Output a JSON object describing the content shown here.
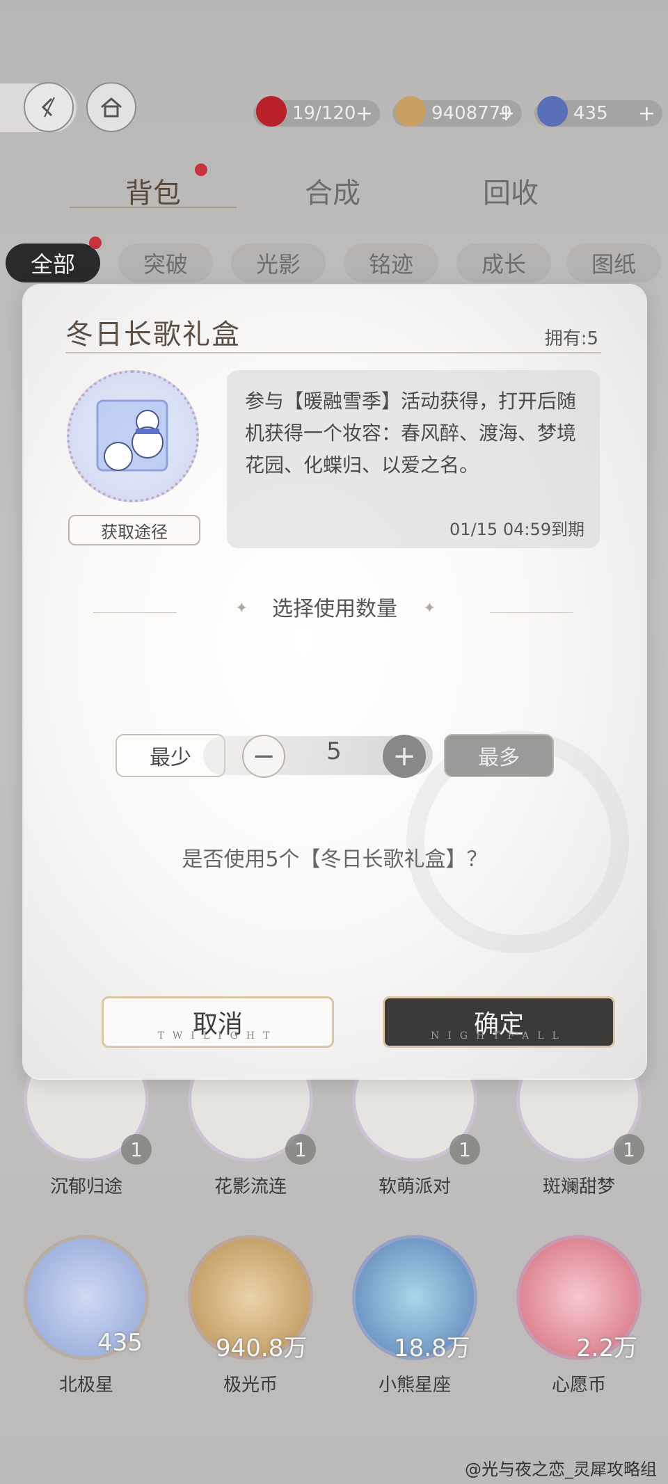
{
  "topbar": {
    "resources": [
      {
        "icon": "apple-icon",
        "value": "19/120",
        "color": "#b8202a"
      },
      {
        "icon": "coin-icon",
        "value": "9408779",
        "color": "#c9a062"
      },
      {
        "icon": "star-gem-icon",
        "value": "435",
        "color": "#5a6fb8"
      }
    ]
  },
  "main_tabs": [
    "背包",
    "合成",
    "回收"
  ],
  "filter_chips": [
    "全部",
    "突破",
    "光影",
    "铭迹",
    "成长",
    "图纸"
  ],
  "background_items": [
    {
      "name": "沉郁归途",
      "count": "1"
    },
    {
      "name": "花影流连",
      "count": "1"
    },
    {
      "name": "软萌派对",
      "count": "1"
    },
    {
      "name": "斑斓甜梦",
      "count": "1"
    },
    {
      "name": "北极星",
      "count": "435"
    },
    {
      "name": "极光币",
      "count": "940.8万"
    },
    {
      "name": "小熊星座",
      "count": "18.8万"
    },
    {
      "name": "心愿币",
      "count": "2.2万"
    }
  ],
  "modal": {
    "title": "冬日长歌礼盒",
    "owned_label": "拥有:5",
    "acquire_label": "获取途径",
    "description": "参与【暖融雪季】活动获得，打开后随机获得一个妆容：春风醉、渡海、梦境花园、化蝶归、以爱之名。",
    "expiry": "01/15 04:59到期",
    "quantity_title": "选择使用数量",
    "min_label": "最少",
    "max_label": "最多",
    "quantity": "5",
    "confirm_question": "是否使用5个【冬日长歌礼盒】？",
    "cancel_label": "取消",
    "cancel_sub": "TWILIGHT",
    "ok_label": "确定",
    "ok_sub": "NIGHTFALL"
  },
  "watermark": "@光与夜之恋_灵犀攻略组"
}
